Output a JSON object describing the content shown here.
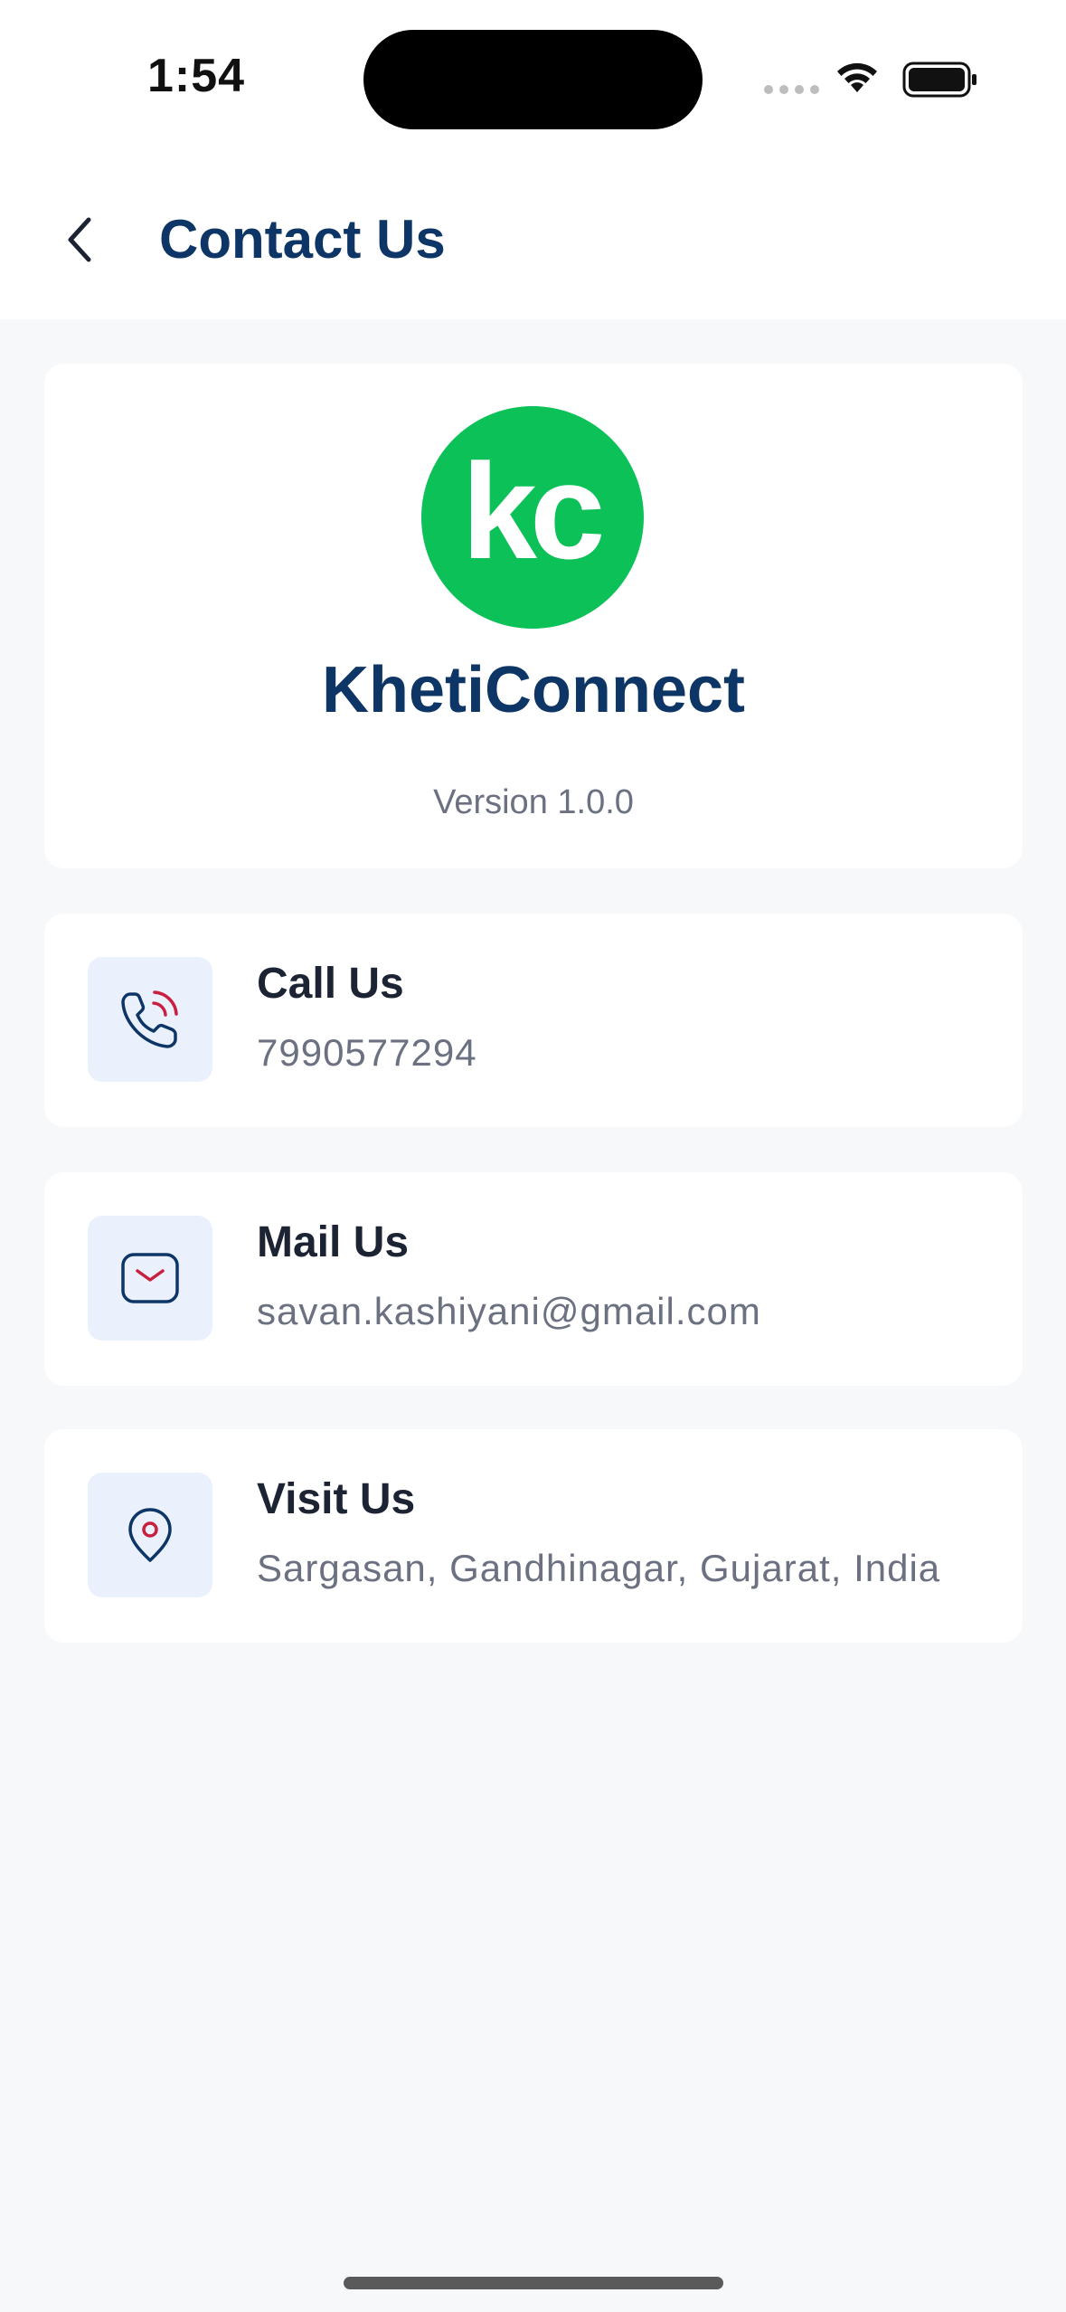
{
  "status_bar": {
    "time": "1:54"
  },
  "header": {
    "title": "Contact Us"
  },
  "brand": {
    "logo_text": "kc",
    "name": "KhetiConnect",
    "version": "Version 1.0.0",
    "logo_color": "#0cc157"
  },
  "contacts": [
    {
      "title": "Call Us",
      "value": "7990577294",
      "icon": "phone-icon"
    },
    {
      "title": "Mail Us",
      "value": "savan.kashiyani@gmail.com",
      "icon": "mail-icon"
    },
    {
      "title": "Visit Us",
      "value": "Sargasan, Gandhinagar, Gujarat, India",
      "icon": "location-pin-icon"
    }
  ],
  "colors": {
    "primary": "#0d3566",
    "accent": "#c8203f",
    "icon_bg": "#eaf1fd",
    "background": "#f7f8fa"
  }
}
